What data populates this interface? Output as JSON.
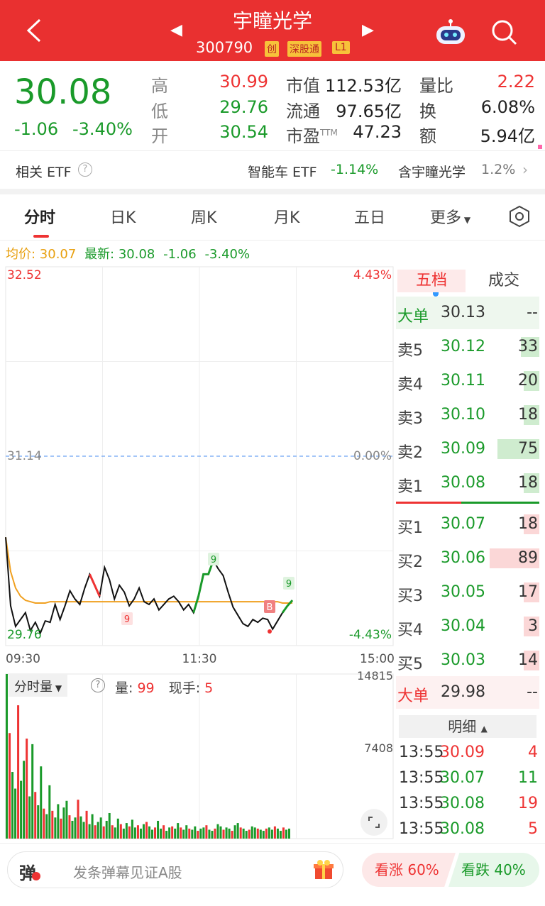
{
  "header": {
    "title": "宇瞳光学",
    "code": "300790",
    "badge_chuang": "创",
    "badge_sgt": "深股通",
    "badge_level": "L1"
  },
  "quote": {
    "price": "30.08",
    "change": "-1.06",
    "change_pct": "-3.40%",
    "stats": [
      {
        "label": "高",
        "value": "30.99"
      },
      {
        "label": "低",
        "value": "29.76"
      },
      {
        "label": "开",
        "value": "30.54"
      }
    ],
    "stats2": [
      {
        "label": "市值",
        "value": "112.53亿"
      },
      {
        "label": "流通",
        "value": "97.65亿"
      },
      {
        "label": "市盈",
        "sup": "TTM",
        "value": "47.23"
      }
    ],
    "stats3": [
      {
        "label": "量比",
        "value": "2.22"
      },
      {
        "label": "换",
        "value": "6.08%"
      },
      {
        "label": "额",
        "value": "5.94亿"
      }
    ]
  },
  "etf": {
    "label": "相关 ETF",
    "name": "智能车 ETF",
    "change": "-1.14%",
    "contains": "含宇瞳光学",
    "weight": "1.2%"
  },
  "tabs": [
    "分时",
    "日K",
    "周K",
    "月K",
    "五日",
    "更多"
  ],
  "line_info": {
    "avg_label": "均价: 30.07",
    "latest_label": "最新: 30.08",
    "change": "-1.06",
    "pct": "-3.40%"
  },
  "chart_data": {
    "type": "line",
    "title": "",
    "ylim": [
      29.76,
      32.52
    ],
    "prev_close": 31.14,
    "y_labels": {
      "top": "32.52",
      "mid": "31.14",
      "bottom": "29.76",
      "top_pct": "4.43%",
      "mid_pct": "0.00%",
      "bottom_pct": "-4.43%"
    },
    "x_labels": [
      "09:30",
      "11:30",
      "15:00"
    ],
    "price": [
      30.55,
      30.05,
      29.9,
      29.95,
      30.0,
      29.87,
      29.93,
      29.85,
      29.94,
      29.93,
      30.06,
      29.95,
      30.05,
      30.16,
      30.1,
      30.06,
      30.18,
      30.28,
      30.2,
      30.12,
      30.33,
      30.24,
      30.1,
      30.2,
      30.15,
      30.05,
      30.1,
      30.18,
      30.08,
      30.06,
      30.1,
      30.02,
      30.06,
      30.1,
      30.12,
      30.08,
      30.02,
      30.06,
      30.0,
      30.12,
      30.28,
      30.28,
      30.38,
      30.32,
      30.27,
      30.15,
      30.04,
      29.98,
      29.92,
      29.9,
      29.95,
      29.93,
      29.96,
      29.95,
      29.88,
      29.94,
      30.0,
      30.05,
      30.09
    ],
    "avg": [
      30.55,
      30.3,
      30.18,
      30.12,
      30.09,
      30.08,
      30.07,
      30.07,
      30.07,
      30.08,
      30.08,
      30.08,
      30.08,
      30.08,
      30.08,
      30.08,
      30.08,
      30.08,
      30.08,
      30.08,
      30.08,
      30.08,
      30.08,
      30.08,
      30.08,
      30.08,
      30.08,
      30.08,
      30.08,
      30.08,
      30.08,
      30.08,
      30.08,
      30.08,
      30.08,
      30.08,
      30.08,
      30.08,
      30.08,
      30.08,
      30.08,
      30.08,
      30.08,
      30.08,
      30.08,
      30.08,
      30.08,
      30.08,
      30.08,
      30.08,
      30.08,
      30.08,
      30.08,
      30.08,
      30.08,
      30.08,
      30.07,
      30.07,
      30.07
    ],
    "markers": [
      "9",
      "9",
      "9",
      "B"
    ]
  },
  "volume": {
    "label": "分时量",
    "vol_label": "量:",
    "vol": "99",
    "hand_label": "现手:",
    "hand": "5",
    "max": "14815",
    "mid": "7408"
  },
  "volume_data": [
    14815,
    9500,
    6000,
    4500,
    12000,
    5200,
    7000,
    9000,
    3800,
    8500,
    4200,
    3000,
    6500,
    2700,
    2200,
    4800,
    2500,
    1900,
    3100,
    1800,
    2800,
    3400,
    2100,
    1600,
    1900,
    3500,
    2000,
    1500,
    2500,
    1300,
    2200,
    1200,
    1500,
    1900,
    1100,
    1600,
    2300,
    1200,
    1000,
    1800,
    1300,
    900,
    1400,
    1100,
    1700,
    1000,
    1200,
    900,
    1300,
    1500,
    1100,
    800,
    1000,
    1600,
    900,
    1200,
    700,
    1000,
    1100,
    900,
    1400,
    1000,
    800,
    1200,
    900,
    800,
    1100,
    700,
    900,
    1000,
    1200,
    800,
    700,
    900,
    1300,
    1100,
    800,
    1000,
    900,
    700,
    1200,
    1400,
    1000,
    900,
    700,
    800,
    1100,
    1000,
    900,
    800,
    700,
    900,
    1000,
    800,
    1100,
    900,
    700,
    1000,
    800,
    900
  ],
  "orderbook": {
    "tab_active": "五档",
    "tab_other": "成交",
    "big_top": {
      "label": "大单",
      "price": "30.13",
      "vol": "--"
    },
    "asks": [
      {
        "label": "卖5",
        "price": "30.12",
        "vol": "33"
      },
      {
        "label": "卖4",
        "price": "30.11",
        "vol": "20"
      },
      {
        "label": "卖3",
        "price": "30.10",
        "vol": "18"
      },
      {
        "label": "卖2",
        "price": "30.09",
        "vol": "75"
      },
      {
        "label": "卖1",
        "price": "30.08",
        "vol": "18"
      }
    ],
    "bids": [
      {
        "label": "买1",
        "price": "30.07",
        "vol": "18"
      },
      {
        "label": "买2",
        "price": "30.06",
        "vol": "89"
      },
      {
        "label": "买3",
        "price": "30.05",
        "vol": "17"
      },
      {
        "label": "买4",
        "price": "30.04",
        "vol": "3"
      },
      {
        "label": "买5",
        "price": "30.03",
        "vol": "14"
      }
    ],
    "big_bottom": {
      "label": "大单",
      "price": "29.98",
      "vol": "--"
    }
  },
  "ticks": {
    "header": "明细",
    "rows": [
      {
        "time": "13:55",
        "price": "30.09",
        "vol": "4"
      },
      {
        "time": "13:55",
        "price": "30.07",
        "vol": "11"
      },
      {
        "time": "13:55",
        "price": "30.08",
        "vol": "19"
      },
      {
        "time": "13:55",
        "price": "30.08",
        "vol": "5"
      }
    ]
  },
  "bottom": {
    "danmu_icon": "弹",
    "placeholder": "发条弹幕见证A股",
    "bull": "看涨 60%",
    "bear": "看跌 40%"
  },
  "colors": {
    "header": "#e93030",
    "up": "#e33333",
    "down": "#1a9a2a",
    "avg": "#f0a020"
  }
}
